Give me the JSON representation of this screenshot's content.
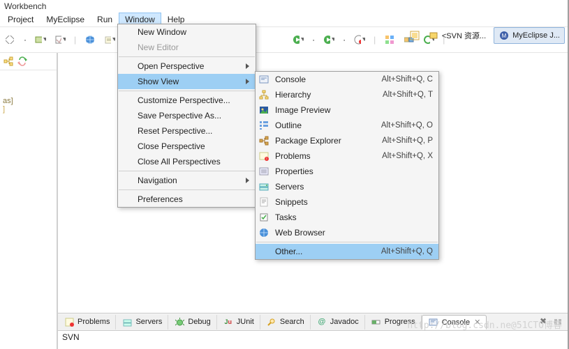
{
  "title": "Workbench",
  "menubar": [
    "Project",
    "MyEclipse",
    "Run",
    "Window",
    "Help"
  ],
  "perspectives": {
    "svn_label": "<SVN 资源...",
    "active_label": "MyEclipse J..."
  },
  "left_panel": {
    "rows": [
      "as]",
      "]"
    ]
  },
  "window_menu": {
    "new_window": "New Window",
    "new_editor": "New Editor",
    "open_perspective": "Open Perspective",
    "show_view": "Show View",
    "customize_perspective": "Customize Perspective...",
    "save_perspective_as": "Save Perspective As...",
    "reset_perspective": "Reset Perspective...",
    "close_perspective": "Close Perspective",
    "close_all_perspectives": "Close All Perspectives",
    "navigation": "Navigation",
    "preferences": "Preferences"
  },
  "show_view_menu": [
    {
      "icon": "console-icon",
      "label": "Console",
      "shortcut": "Alt+Shift+Q, C"
    },
    {
      "icon": "hierarchy-icon",
      "label": "Hierarchy",
      "shortcut": "Alt+Shift+Q, T"
    },
    {
      "icon": "image-icon",
      "label": "Image Preview",
      "shortcut": ""
    },
    {
      "icon": "outline-icon",
      "label": "Outline",
      "shortcut": "Alt+Shift+Q, O"
    },
    {
      "icon": "package-icon",
      "label": "Package Explorer",
      "shortcut": "Alt+Shift+Q, P"
    },
    {
      "icon": "problems-icon",
      "label": "Problems",
      "shortcut": "Alt+Shift+Q, X"
    },
    {
      "icon": "properties-icon",
      "label": "Properties",
      "shortcut": ""
    },
    {
      "icon": "servers-icon",
      "label": "Servers",
      "shortcut": ""
    },
    {
      "icon": "snippets-icon",
      "label": "Snippets",
      "shortcut": ""
    },
    {
      "icon": "tasks-icon",
      "label": "Tasks",
      "shortcut": ""
    },
    {
      "icon": "browser-icon",
      "label": "Web Browser",
      "shortcut": ""
    }
  ],
  "show_view_other": {
    "label": "Other...",
    "shortcut": "Alt+Shift+Q, Q"
  },
  "bottom_tabs": [
    {
      "icon": "problems-icon",
      "label": "Problems"
    },
    {
      "icon": "servers-icon",
      "label": "Servers"
    },
    {
      "icon": "debug-icon",
      "label": "Debug"
    },
    {
      "icon": "junit-icon",
      "label": "JUnit"
    },
    {
      "icon": "search-icon",
      "label": "Search"
    },
    {
      "icon": "javadoc-icon",
      "label": "Javadoc"
    },
    {
      "icon": "progress-icon",
      "label": "Progress"
    },
    {
      "icon": "console-icon",
      "label": "Console",
      "active": true
    }
  ],
  "console_content": "SVN",
  "watermark": "http://blog.csdn.ne@51CTO博客"
}
